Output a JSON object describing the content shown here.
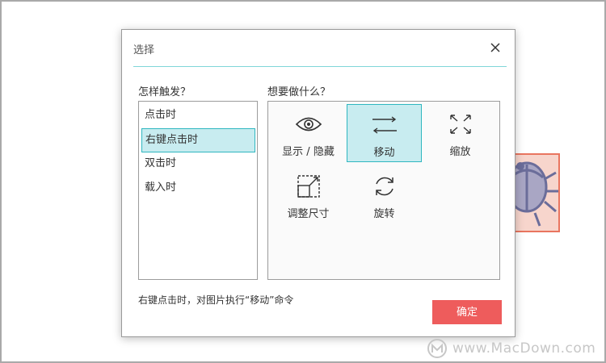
{
  "dialog": {
    "title": "选择",
    "left_heading": "怎样触发？",
    "right_heading": "想要做什么？",
    "summary": "右键点击时，对图片执行“移动”命令",
    "ok_label": "确定"
  },
  "triggers": [
    {
      "label": "点击时",
      "selected": false
    },
    {
      "label": "右键点击时",
      "selected": true
    },
    {
      "label": "双击时",
      "selected": false
    },
    {
      "label": "载入时",
      "selected": false
    }
  ],
  "actions": [
    {
      "label": "显示 / 隐藏",
      "icon": "eye-icon",
      "selected": false
    },
    {
      "label": "移动",
      "icon": "move-arrows-icon",
      "selected": true
    },
    {
      "label": "缩放",
      "icon": "scale-icon",
      "selected": false
    },
    {
      "label": "调整尺寸",
      "icon": "resize-icon",
      "selected": false
    },
    {
      "label": "旋转",
      "icon": "rotate-icon",
      "selected": false
    }
  ],
  "watermark": {
    "text": "www.MacDown.com"
  },
  "colors": {
    "accent": "#2fb7c0",
    "selection_bg": "#c8ecf0",
    "primary_button": "#ee5c5c"
  }
}
